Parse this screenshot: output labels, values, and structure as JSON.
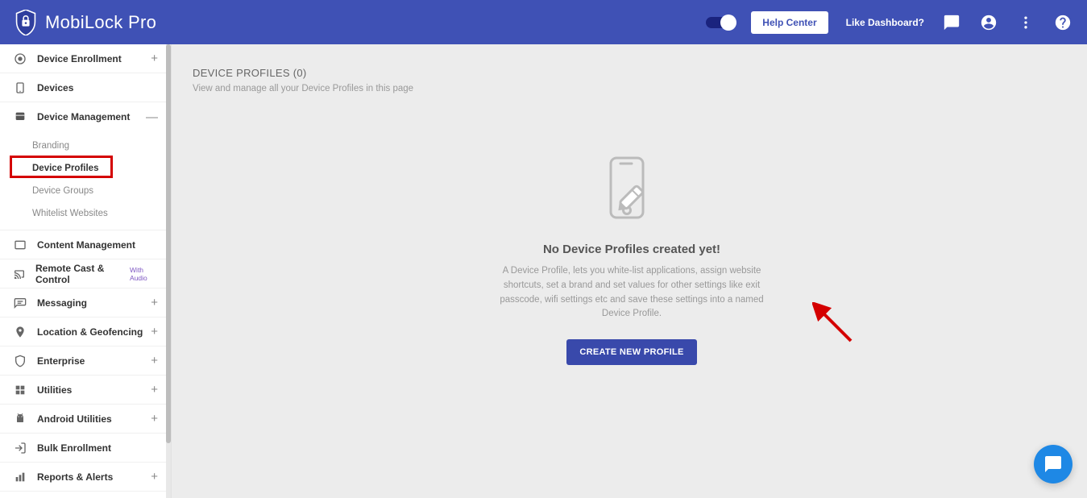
{
  "header": {
    "brand": "MobiLock Pro",
    "help_label": "Help Center",
    "like_dashboard": "Like Dashboard?"
  },
  "sidebar": {
    "items": [
      {
        "label": "Device Enrollment",
        "expander": "+"
      },
      {
        "label": "Devices",
        "expander": ""
      },
      {
        "label": "Device Management",
        "expander": "—"
      },
      {
        "label": "Content Management",
        "expander": ""
      },
      {
        "label": "Remote Cast & Control",
        "badge": "With Audio",
        "expander": ""
      },
      {
        "label": "Messaging",
        "expander": "+"
      },
      {
        "label": "Location & Geofencing",
        "expander": "+"
      },
      {
        "label": "Enterprise",
        "expander": "+"
      },
      {
        "label": "Utilities",
        "expander": "+"
      },
      {
        "label": "Android Utilities",
        "expander": "+"
      },
      {
        "label": "Bulk Enrollment",
        "expander": ""
      },
      {
        "label": "Reports & Alerts",
        "expander": "+"
      }
    ],
    "submenu": [
      {
        "label": "Branding"
      },
      {
        "label": "Device Profiles"
      },
      {
        "label": "Device Groups"
      },
      {
        "label": "Whitelist Websites"
      }
    ]
  },
  "main": {
    "title": "DEVICE PROFILES (0)",
    "subtitle": "View and manage all your Device Profiles in this page",
    "empty_title": "No Device Profiles created yet!",
    "empty_desc": "A Device Profile, lets you white-list applications, assign website shortcuts, set a brand and set values for other settings like exit passcode, wifi settings etc and save these settings into a named Device Profile.",
    "create_label": "CREATE NEW PROFILE"
  }
}
